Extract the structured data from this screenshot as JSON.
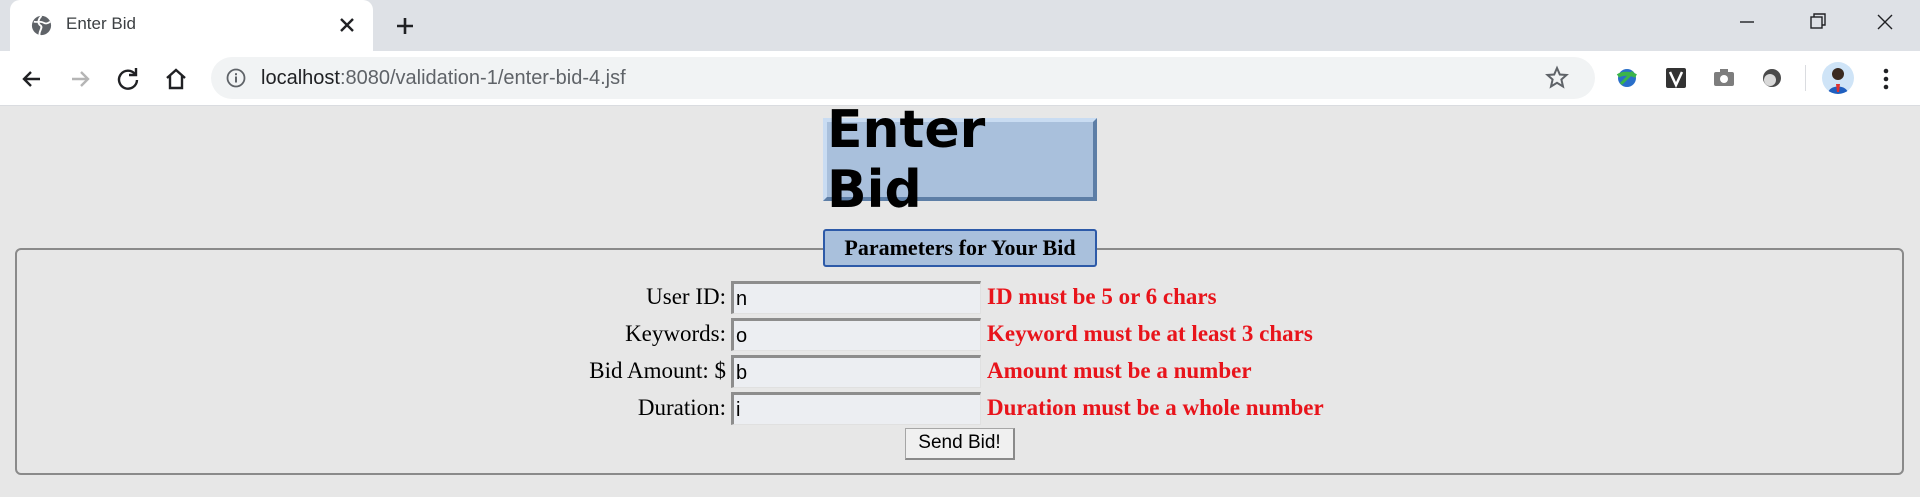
{
  "browser": {
    "tab_title": "Enter Bid",
    "url_host": "localhost",
    "url_path": ":8080/validation-1/enter-bid-4.jsf"
  },
  "page": {
    "title": "Enter Bid",
    "legend": "Parameters for Your Bid",
    "fields": [
      {
        "label": "User ID:",
        "value": "n",
        "error": "ID must be 5 or 6 chars"
      },
      {
        "label": "Keywords:",
        "value": "o",
        "error": "Keyword must be at least 3 chars"
      },
      {
        "label": "Bid Amount: $",
        "value": "b",
        "error": "Amount must be a number"
      },
      {
        "label": "Duration:",
        "value": "i",
        "error": "Duration must be a whole number"
      }
    ],
    "submit_label": "Send Bid!"
  },
  "colors": {
    "error": "#e8141b",
    "title_bg": "#a9c0dc",
    "page_bg": "#e7e7e7"
  }
}
